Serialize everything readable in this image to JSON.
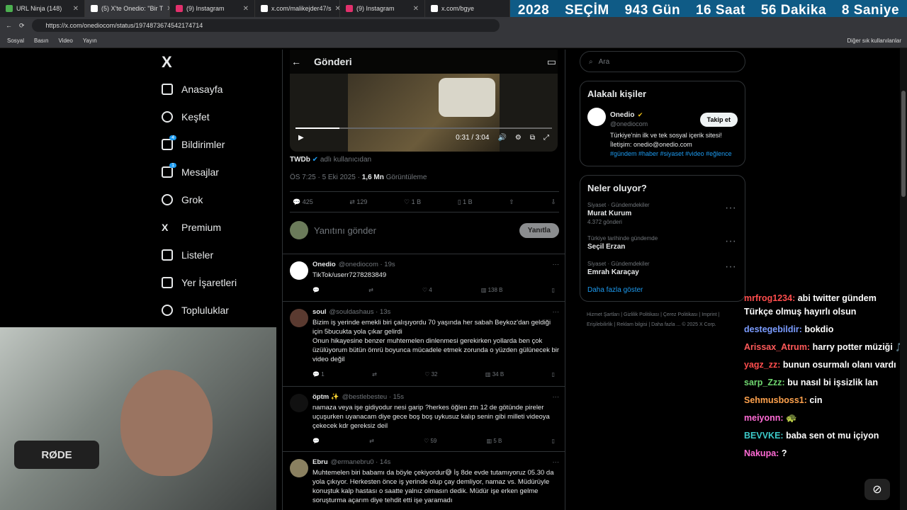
{
  "browser": {
    "tabs": [
      {
        "label": "URL Ninja (148)",
        "color": "#4caf50"
      },
      {
        "label": "(5) X'te Onedio: \"Bir T",
        "color": "#000000"
      },
      {
        "label": "(9) Instagram",
        "color": "#e1306c"
      },
      {
        "label": "x.com/malikejder47/s",
        "color": "#000000"
      },
      {
        "label": "(9) Instagram",
        "color": "#e1306c"
      },
      {
        "label": "x.com/bgye",
        "color": "#000000"
      }
    ],
    "url": "https://x.com/onediocom/status/1974873674542174714",
    "bookmarks": [
      "Sosyal",
      "Basın",
      "Video",
      "Yayın"
    ],
    "bookmarks_right": "Diğer sık kullanılanlar"
  },
  "countdown": {
    "year": "2028",
    "label": "SEÇİM",
    "days": "943 Gün",
    "hours": "16 Saat",
    "minutes": "56 Dakika",
    "seconds": "8 Saniye"
  },
  "nav": {
    "logo": "X",
    "items": [
      {
        "label": "Anasayfa",
        "icon": "home-icon"
      },
      {
        "label": "Keşfet",
        "icon": "search-icon"
      },
      {
        "label": "Bildirimler",
        "icon": "bell-icon",
        "badge": "4"
      },
      {
        "label": "Mesajlar",
        "icon": "mail-icon",
        "badge": "1"
      },
      {
        "label": "Grok",
        "icon": "grok-icon"
      },
      {
        "label": "Premium",
        "icon": "x-icon"
      },
      {
        "label": "Listeler",
        "icon": "list-icon"
      },
      {
        "label": "Yer İşaretleri",
        "icon": "bookmark-icon"
      },
      {
        "label": "Topluluklar",
        "icon": "people-icon"
      }
    ]
  },
  "post": {
    "header_title": "Gönderi",
    "video_time": "0:31 / 3:04",
    "progress_fraction": 0.17,
    "source_user": "TWDb",
    "source_suffix": "adlı kullanıcıdan",
    "timestamp": "ÖS 7:25 · 5 Eki 2025 ·",
    "views": "1,6 Mn",
    "views_label": "Görüntüleme",
    "replies": "425",
    "reposts": "129",
    "likes": "1 B",
    "bookmarks": "1 B",
    "reply_placeholder": "Yanıtını gönder",
    "reply_button": "Yanıtla"
  },
  "replies": [
    {
      "name": "Onedio",
      "handle": "@onediocom · 19s",
      "text": "TikTok/userr7278283849",
      "r": "",
      "rt": "",
      "l": "4",
      "v": "138 B",
      "avatar_color": "#ffffff"
    },
    {
      "name": "soul",
      "handle": "@souldashaus · 13s",
      "text": "Bizim iş yerinde emekli biri çalışıyordu 70 yaşında her sabah Beykoz'dan geldiği için 5bucukta yola çıkar gelirdi\nOnun hikayesine benzer muhtemelen dinlenmesi gerekirken yollarda ben çok üzülüyorum bütün ömrü boyunca mücadele etmek zorunda o yüzden gülünecek bir video değil",
      "r": "1",
      "rt": "",
      "l": "32",
      "v": "34 B",
      "avatar_color": "#5a3a30"
    },
    {
      "name": "öptm ✨",
      "handle": "@bestlebesteu · 15s",
      "text": "namaza veya işe gidiyodur nesi garip ?herkes öğlen ztn 12 de götünde pireler uçuşurken uyanacam diye gece boş boş uykusuz kalıp senin gibi milleti videoya çekecek kdr gereksiz deil",
      "r": "",
      "rt": "",
      "l": "59",
      "v": "5 B",
      "avatar_color": "#111111"
    },
    {
      "name": "Ebru",
      "handle": "@ermanebru0 · 14s",
      "text": "Muhtemelen biri babamı da böyle çekiyordur😅 İş 8de evde tutamıyoruz 05.30 da yola çıkıyor. Herkesten önce iş yerinde olup çay demliyor, namaz vs. Müdürüyle konuştuk kalp hastası o saatte yalnız olmasın dedik. Müdür işe erken gelme soruşturma açarım diye tehdit etti işe yaramadı",
      "r": "",
      "rt": "",
      "l": "",
      "v": "",
      "avatar_color": "#8a8060"
    }
  ],
  "sidebar": {
    "search_placeholder": "Ara",
    "related_title": "Alakalı kişiler",
    "related_name": "Onedio",
    "related_handle": "@onediocom",
    "follow_label": "Takip et",
    "related_bio": "Türkiye'nin ilk ve tek sosyal içerik sitesi! İletişim: onedio@onedio.com",
    "related_tags": "#gündem #haber #siyaset #video #eğlence",
    "trends_title": "Neler oluyor?",
    "trends": [
      {
        "cat": "Siyaset · Gündemdekiler",
        "name": "Murat Kurum",
        "count": "4.372 gönderi"
      },
      {
        "cat": "Türkiye tarihinde gündemde",
        "name": "Seçil Erzan",
        "count": ""
      },
      {
        "cat": "Siyaset · Gündemdekiler",
        "name": "Emrah Karaçay",
        "count": ""
      }
    ],
    "show_more": "Daha fazla göster",
    "footer": "Hizmet Şartları | Gizlilik Politikası | Çerez Politikası | Imprint | Erişilebilirlik | Reklam bilgisi | Daha fazla ... © 2025 X Corp."
  },
  "webcam": {
    "mic_brand": "RØDE"
  },
  "chat": [
    {
      "user": "mrfrog1234:",
      "text": "abi twitter gündem Türkçe olmuş hayırlı olsun",
      "color": "#ff4d4d"
    },
    {
      "user": "destegebildir:",
      "text": "bokdio",
      "color": "#7b9cff"
    },
    {
      "user": "Arissax_Atrum:",
      "text": "harry potter müziği 🎵",
      "color": "#ff5a5a"
    },
    {
      "user": "yagz_zz:",
      "text": "bunun osurmalı olanı vardı",
      "color": "#ff4d4d"
    },
    {
      "user": "sarp_Zzz:",
      "text": "bu nasıl bi işsizlik lan",
      "color": "#6fd66f"
    },
    {
      "user": "Sehmusboss1:",
      "text": "cin",
      "color": "#ffa24d"
    },
    {
      "user": "meiyonn:",
      "text": "🐢",
      "color": "#ff6bd5"
    },
    {
      "user": "BEVVKE:",
      "text": "baba sen ot mu içiyon",
      "color": "#3cc9c9"
    },
    {
      "user": "Nakupa:",
      "text": "?",
      "color": "#ff6bd5"
    }
  ]
}
